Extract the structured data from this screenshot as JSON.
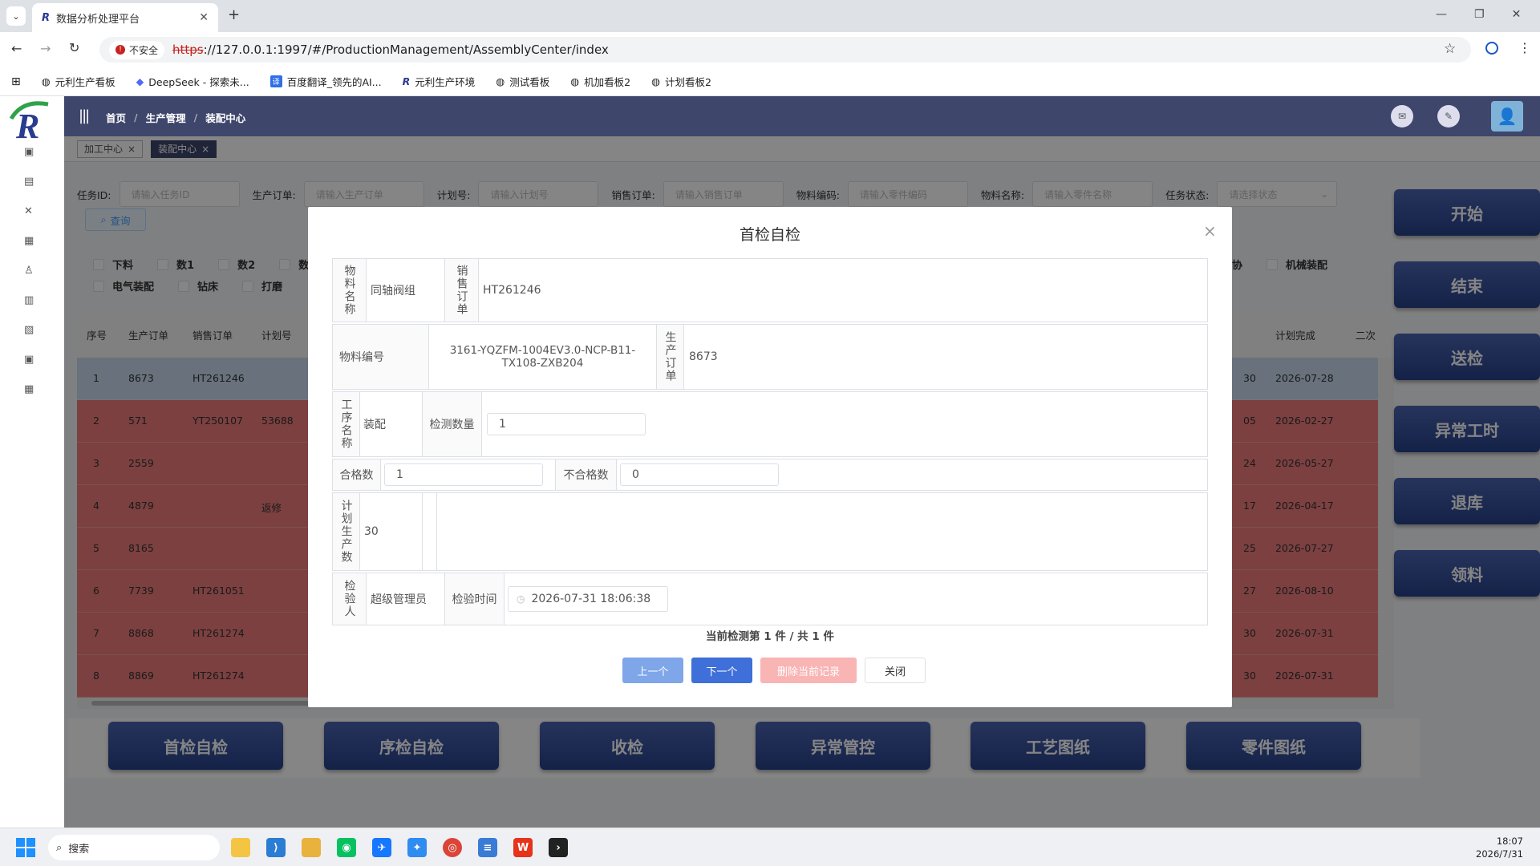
{
  "browser": {
    "tab_title": "数据分析处理平台",
    "new_tab": "+",
    "insecure_label": "不安全",
    "url_scheme": "https",
    "url_rest": "://127.0.0.1:1997/#/ProductionManagement/AssemblyCenter/index",
    "bookmarks": [
      "元利生产看板",
      "DeepSeek - 探索未...",
      "百度翻译_领先的AI...",
      "元利生产环境",
      "测试看板",
      "机加看板2",
      "计划看板2"
    ]
  },
  "header": {
    "breadcrumb": [
      "首页",
      "生产管理",
      "装配中心"
    ],
    "separator": "/"
  },
  "tags": [
    {
      "label": "加工中心",
      "close": "×"
    },
    {
      "label": "装配中心",
      "close": "×"
    }
  ],
  "filters": [
    {
      "label": "任务ID:",
      "placeholder": "请输入任务ID"
    },
    {
      "label": "生产订单:",
      "placeholder": "请输入生产订单"
    },
    {
      "label": "计划号:",
      "placeholder": "请输入计划号"
    },
    {
      "label": "销售订单:",
      "placeholder": "请输入销售订单"
    },
    {
      "label": "物料编码:",
      "placeholder": "请输入零件编码"
    },
    {
      "label": "物料名称:",
      "placeholder": "请输入零件名称"
    },
    {
      "label": "任务状态:",
      "placeholder": "请选择状态"
    }
  ],
  "query_button": "查询",
  "checkboxes_row1": [
    "下料",
    "数1",
    "数2",
    "数"
  ],
  "checkboxes_row2": [
    "电气装配",
    "钻床",
    "打磨"
  ],
  "checkboxes_right": [
    "协",
    "机械装配"
  ],
  "table": {
    "headers_left": [
      "序号",
      "生产订单",
      "销售订单",
      "计划号"
    ],
    "headers_right": [
      "计划完成",
      "二次"
    ],
    "rows": [
      {
        "no": "1",
        "order": "8673",
        "sales": "HT261246",
        "plan": "",
        "r1": "30",
        "finish": "2026-07-28"
      },
      {
        "no": "2",
        "order": "571",
        "sales": "YT250107",
        "plan": "53688",
        "r1": "05",
        "finish": "2026-02-27"
      },
      {
        "no": "3",
        "order": "2559",
        "sales": "",
        "plan": "",
        "r1": "24",
        "finish": "2026-05-27"
      },
      {
        "no": "4",
        "order": "4879",
        "sales": "",
        "plan": "返修",
        "r1": "17",
        "finish": "2026-04-17"
      },
      {
        "no": "5",
        "order": "8165",
        "sales": "",
        "plan": "",
        "r1": "25",
        "finish": "2026-07-27"
      },
      {
        "no": "6",
        "order": "7739",
        "sales": "HT261051",
        "plan": "",
        "r1": "27",
        "finish": "2026-08-10"
      },
      {
        "no": "7",
        "order": "8868",
        "sales": "HT261274",
        "plan": "",
        "r1": "30",
        "finish": "2026-07-31"
      },
      {
        "no": "8",
        "order": "8869",
        "sales": "HT261274",
        "plan": "",
        "r1": "30",
        "finish": "2026-07-31"
      }
    ]
  },
  "right_buttons": [
    "开始",
    "结束",
    "送检",
    "异常工时",
    "退库",
    "领料"
  ],
  "bottom_buttons": [
    "首检自检",
    "序检自检",
    "收检",
    "异常管控",
    "工艺图纸",
    "零件图纸"
  ],
  "modal": {
    "title": "首检自检",
    "close": "×",
    "material_name_label": "物料名称",
    "material_name": "同轴阀组",
    "sales_order_label": "销售订单",
    "sales_order": "HT261246",
    "material_code_label": "物料编号",
    "material_code": "3161-YQZFM-1004EV3.0-NCP-B11-TX108-ZXB204",
    "prod_order_label": "生产订单",
    "prod_order": "8673",
    "process_label": "工序名称",
    "process": "装配",
    "inspect_qty_label": "检测数量",
    "inspect_qty": "1",
    "pass_label": "合格数",
    "pass_qty": "1",
    "fail_label": "不合格数",
    "fail_qty": "0",
    "plan_qty_label": "计划生产数",
    "plan_qty": "30",
    "inspector_label": "检验人",
    "inspector": "超级管理员",
    "time_label": "检验时间",
    "time": "2026-07-31 18:06:38",
    "progress": "当前检测第 1 件 / 共 1 件",
    "btn_prev": "上一个",
    "btn_next": "下一个",
    "btn_delete": "删除当前记录",
    "btn_close": "关闭"
  },
  "taskbar": {
    "search": "搜索",
    "time": "18:07",
    "date": "2026/7/31"
  }
}
